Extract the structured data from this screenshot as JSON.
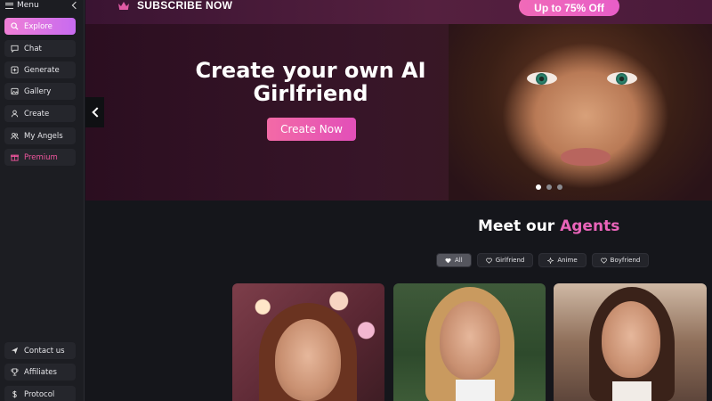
{
  "sidebar": {
    "menu_label": "Menu",
    "items": [
      {
        "label": "Explore",
        "icon": "search-icon",
        "active": true
      },
      {
        "label": "Chat",
        "icon": "chat-bubble-icon"
      },
      {
        "label": "Generate",
        "icon": "plus-square-icon"
      },
      {
        "label": "Gallery",
        "icon": "image-icon"
      },
      {
        "label": "Create",
        "icon": "user-icon"
      },
      {
        "label": "My Angels",
        "icon": "users-icon"
      },
      {
        "label": "Premium",
        "icon": "gift-icon",
        "color": "#f0569e"
      }
    ],
    "bottom_items": [
      {
        "label": "Contact us",
        "icon": "send-icon"
      },
      {
        "label": "Affiliates",
        "icon": "trophy-icon"
      },
      {
        "label": "Protocol",
        "icon": "dollar-icon"
      }
    ]
  },
  "banner": {
    "subscribe_text": "SUBSCRIBE NOW",
    "promo_text": "Up to 75% Off"
  },
  "hero": {
    "title": "Create your own AI Girlfriend",
    "button": "Create Now",
    "slides": 3,
    "active_slide": 1
  },
  "agents": {
    "title_prefix": "Meet our",
    "title_accent": "Agents",
    "filters": [
      {
        "label": "All",
        "active": true
      },
      {
        "label": "Girlfriend"
      },
      {
        "label": "Anime"
      },
      {
        "label": "Boyfriend"
      }
    ],
    "card_count": 3
  },
  "colors": {
    "accent": "#e964b9",
    "sidebar_bg": "#1c1d22",
    "page_bg": "#15161b",
    "active_gradient_start": "#f07fd6",
    "active_gradient_end": "#c76bf0"
  }
}
